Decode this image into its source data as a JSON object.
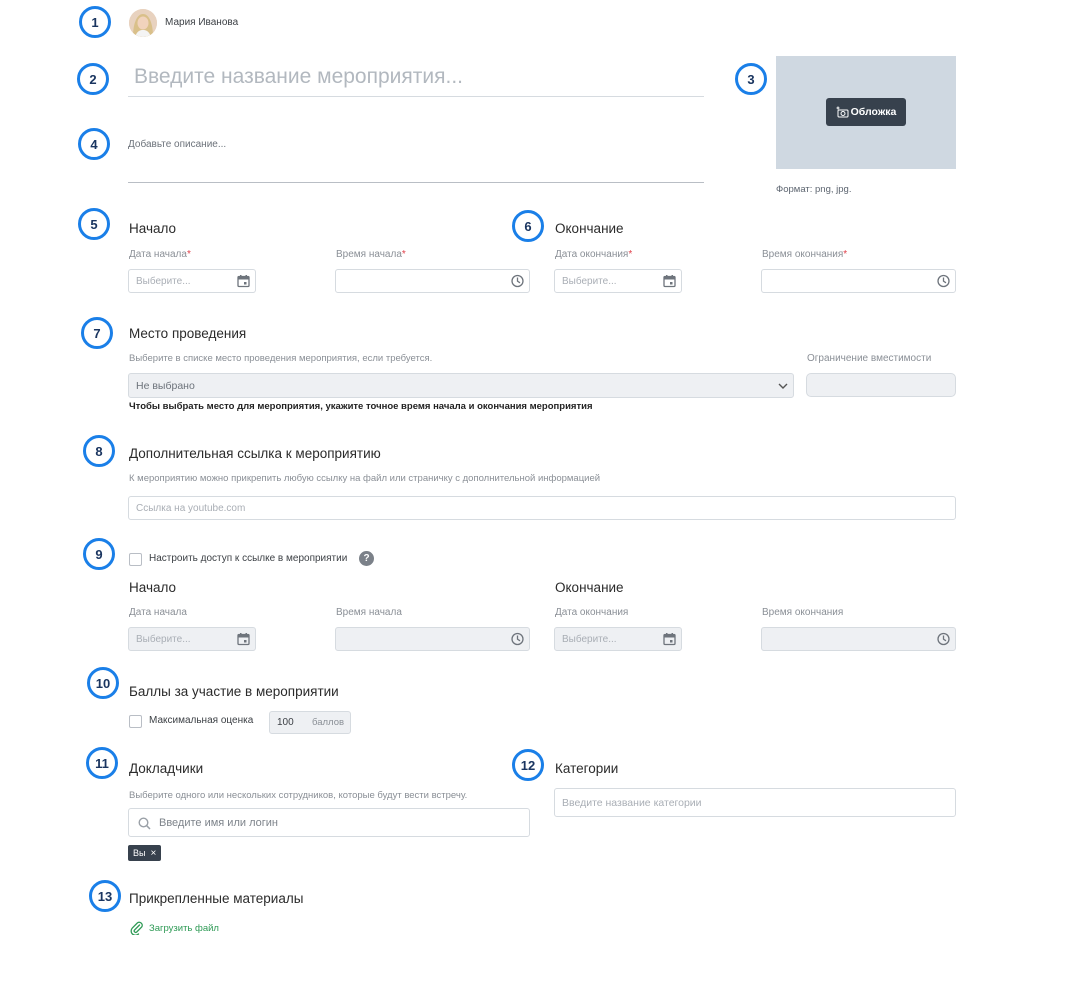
{
  "author": {
    "name": "Мария Иванова"
  },
  "markers": [
    "1",
    "2",
    "3",
    "4",
    "5",
    "6",
    "7",
    "8",
    "9",
    "10",
    "11",
    "12",
    "13"
  ],
  "event": {
    "title_placeholder": "Введите название мероприятия...",
    "description_placeholder": "Добавьте описание..."
  },
  "cover": {
    "button_label": "Обложка",
    "format_hint": "Формат: png, jpg."
  },
  "schedule": {
    "start": {
      "heading": "Начало",
      "date_label": "Дата начала",
      "time_label": "Время начала",
      "date_placeholder": "Выберите..."
    },
    "end": {
      "heading": "Окончание",
      "date_label": "Дата окончания",
      "time_label": "Время окончания",
      "date_placeholder": "Выберите..."
    },
    "required_mark": "*"
  },
  "venue": {
    "heading": "Место проведения",
    "hint": "Выберите в списке место проведения мероприятия, если требуется.",
    "selected": "Не выбрано",
    "warning": "Чтобы выбрать место для мероприятия, укажите точное время начала и окончания мероприятия",
    "capacity_label": "Ограничение вместимости"
  },
  "extra_link": {
    "heading": "Дополнительная ссылка к мероприятию",
    "hint": "К мероприятию можно прикрепить любую ссылку на файл или страничку с дополнительной информацией",
    "placeholder": "Ссылка на youtube.com"
  },
  "link_access": {
    "checkbox_label": "Настроить доступ к ссылке в мероприятии",
    "help": "?",
    "start": {
      "heading": "Начало",
      "date_label": "Дата начала",
      "time_label": "Время начала",
      "date_placeholder": "Выберите..."
    },
    "end": {
      "heading": "Окончание",
      "date_label": "Дата окончания",
      "time_label": "Время окончания",
      "date_placeholder": "Выберите..."
    }
  },
  "points": {
    "heading": "Баллы за участие в мероприятии",
    "checkbox_label": "Максимальная оценка",
    "value": "100",
    "unit": "баллов"
  },
  "speakers": {
    "heading": "Докладчики",
    "hint": "Выберите одного или нескольких сотрудников, которые будут вести встречу.",
    "search_placeholder": "Введите имя или логин",
    "tags": [
      {
        "label": "Вы",
        "remove": "×"
      }
    ]
  },
  "categories": {
    "heading": "Категории",
    "placeholder": "Введите название категории"
  },
  "materials": {
    "heading": "Прикрепленные материалы",
    "upload_label": "Загрузить файл"
  },
  "colors": {
    "marker_border": "#1a7fe8",
    "upload_green": "#2e9a55",
    "cover_bg": "#cfd8e1",
    "cover_button": "#37414d"
  },
  "icons": [
    "calendar-icon",
    "clock-icon",
    "chevron-down-icon",
    "search-icon",
    "help-icon",
    "paperclip-icon",
    "add-photo-icon",
    "close-icon",
    "avatar"
  ]
}
